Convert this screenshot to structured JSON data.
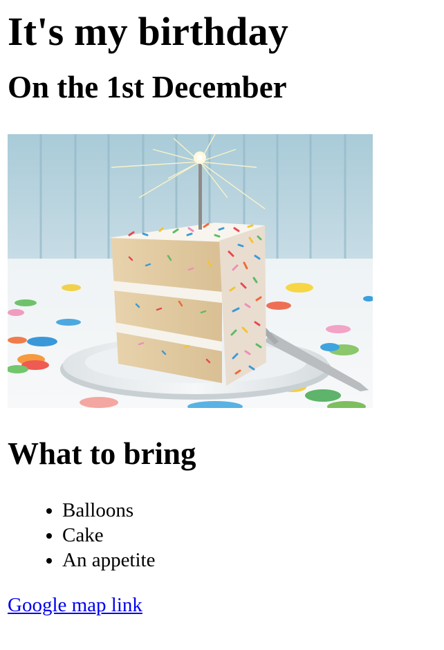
{
  "heading": "It's my birthday",
  "subheading": "On the 1st December",
  "image": {
    "alt": "Slice of sprinkle birthday cake with a sparkler",
    "icon": "cake-photo"
  },
  "bring": {
    "title": "What to bring",
    "items": [
      "Balloons",
      "Cake",
      "An appetite"
    ]
  },
  "link": {
    "label": "Google map link",
    "color": "#0000ee"
  }
}
